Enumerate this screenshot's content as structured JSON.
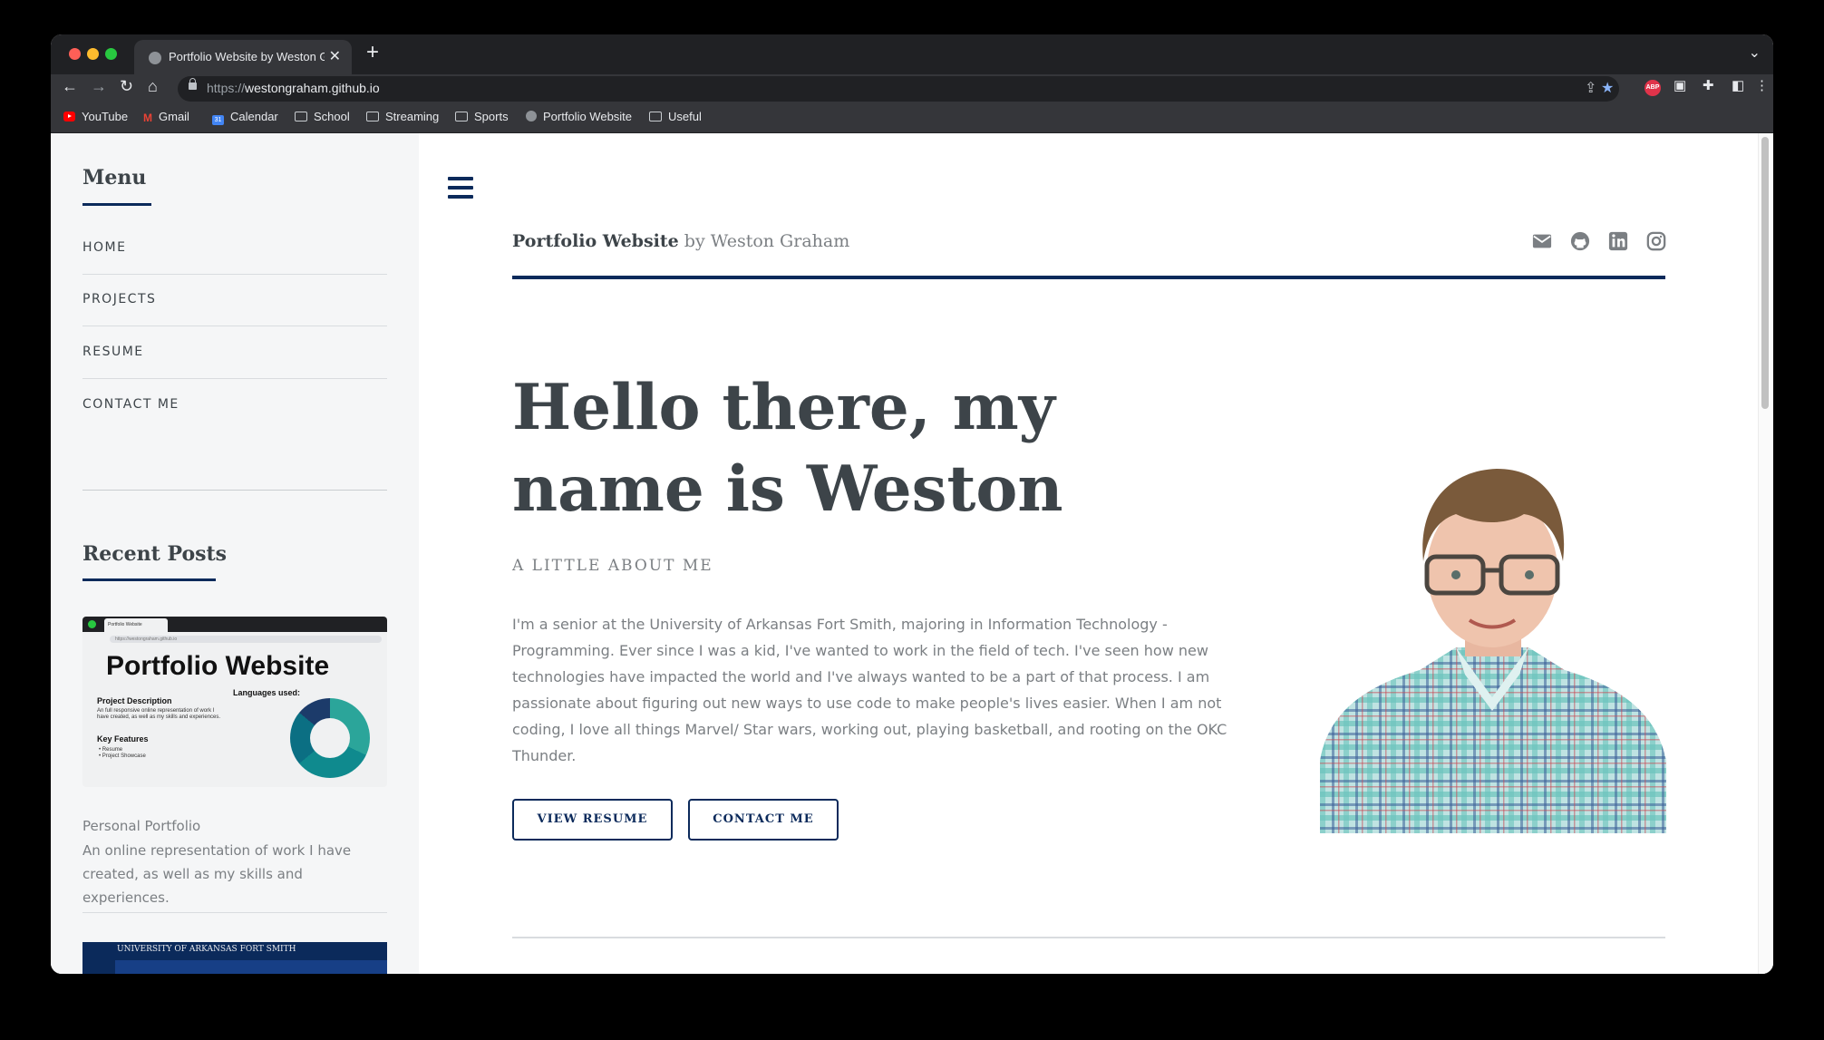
{
  "browser": {
    "tab_title": "Portfolio Website by Weston Graham",
    "url_scheme": "https://",
    "url_host": "westongraham.github.io",
    "bookmarks": [
      {
        "label": "YouTube",
        "icon": "youtube-icon"
      },
      {
        "label": "Gmail",
        "icon": "gmail-icon"
      },
      {
        "label": "Calendar",
        "icon": "calendar-icon"
      },
      {
        "label": "School",
        "icon": "folder-icon"
      },
      {
        "label": "Streaming",
        "icon": "folder-icon"
      },
      {
        "label": "Sports",
        "icon": "folder-icon"
      },
      {
        "label": "Portfolio Website",
        "icon": "globe-icon"
      },
      {
        "label": "Useful",
        "icon": "folder-icon"
      }
    ],
    "abp_label": "ABP",
    "colors": {
      "traffic_close": "#ff5f57",
      "traffic_min": "#febc2e",
      "traffic_max": "#28c840"
    }
  },
  "sidebar": {
    "menu_title": "Menu",
    "nav": [
      {
        "label": "HOME"
      },
      {
        "label": "PROJECTS"
      },
      {
        "label": "RESUME"
      },
      {
        "label": "CONTACT ME"
      }
    ],
    "recent_title": "Recent Posts",
    "post": {
      "thumbnail": {
        "tab_label": "Portfolio Website",
        "url": "https://westongraham.github.io",
        "title": "Portfolio Website",
        "project_description_heading": "Project Description",
        "project_description_text": "An full responsive online representation of work I have created, as well as my skills and experiences.",
        "languages_heading": "Languages used:",
        "key_features_heading": "Key Features",
        "features": [
          "• Resume",
          "• Project Showcase"
        ]
      },
      "title": "Personal Portfolio",
      "description": "An online representation of work I have created, as well as my skills and experiences."
    },
    "next_post_thumbnail_text": "UNIVERSITY OF ARKANSAS FORT SMITH"
  },
  "header": {
    "site_name": "Portfolio Website",
    "by_text": "by Weston Graham",
    "social": [
      "email-icon",
      "github-icon",
      "linkedin-icon",
      "instagram-icon"
    ],
    "accent": "#0b2a5b"
  },
  "main": {
    "hero_heading": "Hello there, my name is Weston",
    "about_label": "A LITTLE ABOUT ME",
    "about_text": "I'm a senior at the University of Arkansas Fort Smith, majoring in Information Technology - Programming. Ever since I was a kid, I've wanted to work in the field of tech. I've seen how new technologies have impacted the world and I've always wanted to be a part of that process. I am passionate about figuring out new ways to use code to make people's lives easier. When I am not coding, I love all things Marvel/ Star wars, working out, playing basketball, and rooting on the OKC Thunder.",
    "buttons": {
      "view_resume": "VIEW RESUME",
      "contact_me": "CONTACT ME"
    }
  }
}
